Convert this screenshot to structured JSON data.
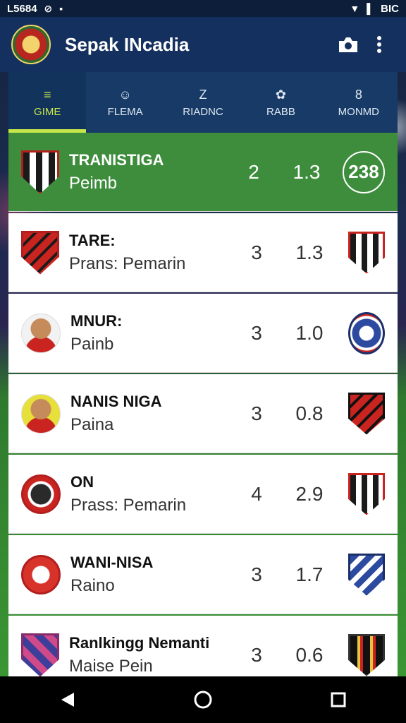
{
  "status_bar": {
    "time": "L5684",
    "right_text": "BIC"
  },
  "app_bar": {
    "title": "Sepak INcadia",
    "icons": [
      "team-logo",
      "camera-icon",
      "more-vert-icon"
    ]
  },
  "tabs": [
    {
      "label": "GIME",
      "icon": "≡",
      "active": true
    },
    {
      "label": "FLEMA",
      "icon": "☺",
      "active": false
    },
    {
      "label": "RIADNC",
      "icon": "Z",
      "active": false
    },
    {
      "label": "RABB",
      "icon": "✿",
      "active": false
    },
    {
      "label": "MONMD",
      "icon": "8",
      "active": false
    }
  ],
  "rows": [
    {
      "name": "TRANISTIGA",
      "sub": "Peimb",
      "stat_a": "2",
      "stat_b": "1.3",
      "team_text": "238",
      "highlight": true
    },
    {
      "name": "TARE:",
      "sub": "Prans: Pemarin",
      "stat_a": "3",
      "stat_b": "1.3"
    },
    {
      "name": "MNUR:",
      "sub": "Painb",
      "stat_a": "3",
      "stat_b": "1.0"
    },
    {
      "name": "NANIS NIGA",
      "sub": "Paina",
      "stat_a": "3",
      "stat_b": "0.8"
    },
    {
      "name": "ON",
      "sub": "Prass: Pemarin",
      "stat_a": "4",
      "stat_b": "2.9"
    },
    {
      "name": "WANI-NISA",
      "sub": "Raino",
      "stat_a": "3",
      "stat_b": "1.7"
    },
    {
      "name": "Ranlkingg Nemanti",
      "sub": "Maise Pein",
      "stat_a": "3",
      "stat_b": "0.6"
    }
  ],
  "colors": {
    "accent": "#c7e64b",
    "highlight_row": "#3e8d3d",
    "app_bar": "#14305e"
  }
}
